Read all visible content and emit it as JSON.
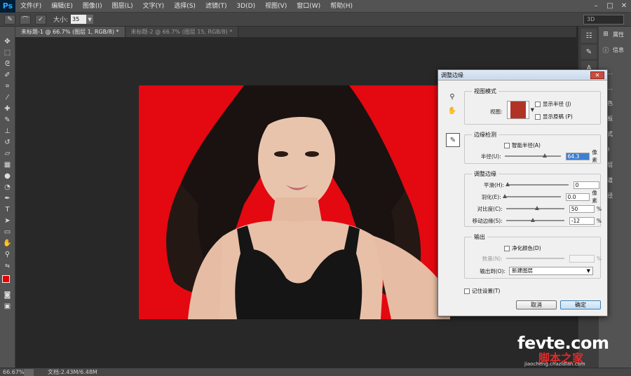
{
  "app": {
    "logo": "Ps"
  },
  "menu": [
    "文件(F)",
    "编辑(E)",
    "图像(I)",
    "图层(L)",
    "文字(Y)",
    "选择(S)",
    "滤镜(T)",
    "3D(D)",
    "视图(V)",
    "窗口(W)",
    "帮助(H)"
  ],
  "options": {
    "size_label": "大小:",
    "size_value": "35",
    "workspace": "3D"
  },
  "tabs": [
    {
      "label": "未标题-1 @ 66.7% (图层 1, RGB/8) *",
      "active": true
    },
    {
      "label": "未标题-2 @ 66.7% (图层 15, RGB/8) *",
      "active": false
    }
  ],
  "panels": {
    "dock1": [
      "属性",
      "信息"
    ],
    "dock2": [
      "色...",
      "直...",
      "颜色",
      "色板",
      "样式",
      "3D",
      "图层",
      "通道",
      "路径"
    ]
  },
  "status": {
    "zoom": "66.67%",
    "doc": "文档:2.43M/6.48M"
  },
  "colors": {
    "foreground": "#e60000",
    "background": "#ffffff",
    "canvas_red": "#e40811"
  },
  "dialog": {
    "title": "调整边缘",
    "view_mode": {
      "title": "视图模式",
      "view_label": "视图:",
      "show_radius": "显示半径 (J)",
      "show_original": "显示原稿 (P)"
    },
    "edge_detection": {
      "title": "边缘检测",
      "smart_radius": "智能半径(A)",
      "radius_label": "半径(U):",
      "radius_value": "64.3",
      "radius_fraction": 0.65,
      "radius_unit": "像素"
    },
    "adjust_edge": {
      "title": "调整边缘",
      "rows": [
        {
          "label": "平滑(H):",
          "value": "0",
          "unit": "",
          "fraction": 0.0
        },
        {
          "label": "羽化(E):",
          "value": "0.0",
          "unit": "像素",
          "fraction": 0.0
        },
        {
          "label": "对比度(C):",
          "value": "50",
          "unit": "%",
          "fraction": 0.5
        },
        {
          "label": "移动边缘(S):",
          "value": "-12",
          "unit": "%",
          "fraction": 0.44
        }
      ]
    },
    "output": {
      "title": "输出",
      "decontaminate": "净化颜色(D)",
      "amount_label": "数量(N):",
      "amount_unit": "%",
      "output_to_label": "输出到(O):",
      "output_to_value": "新建图层"
    },
    "remember": "记住设置(T)",
    "cancel": "取消",
    "ok": "确定"
  },
  "watermark": {
    "main": "fevte.com",
    "sub": "脚本之家",
    "url": "jiaocheng.chazidian.com"
  }
}
